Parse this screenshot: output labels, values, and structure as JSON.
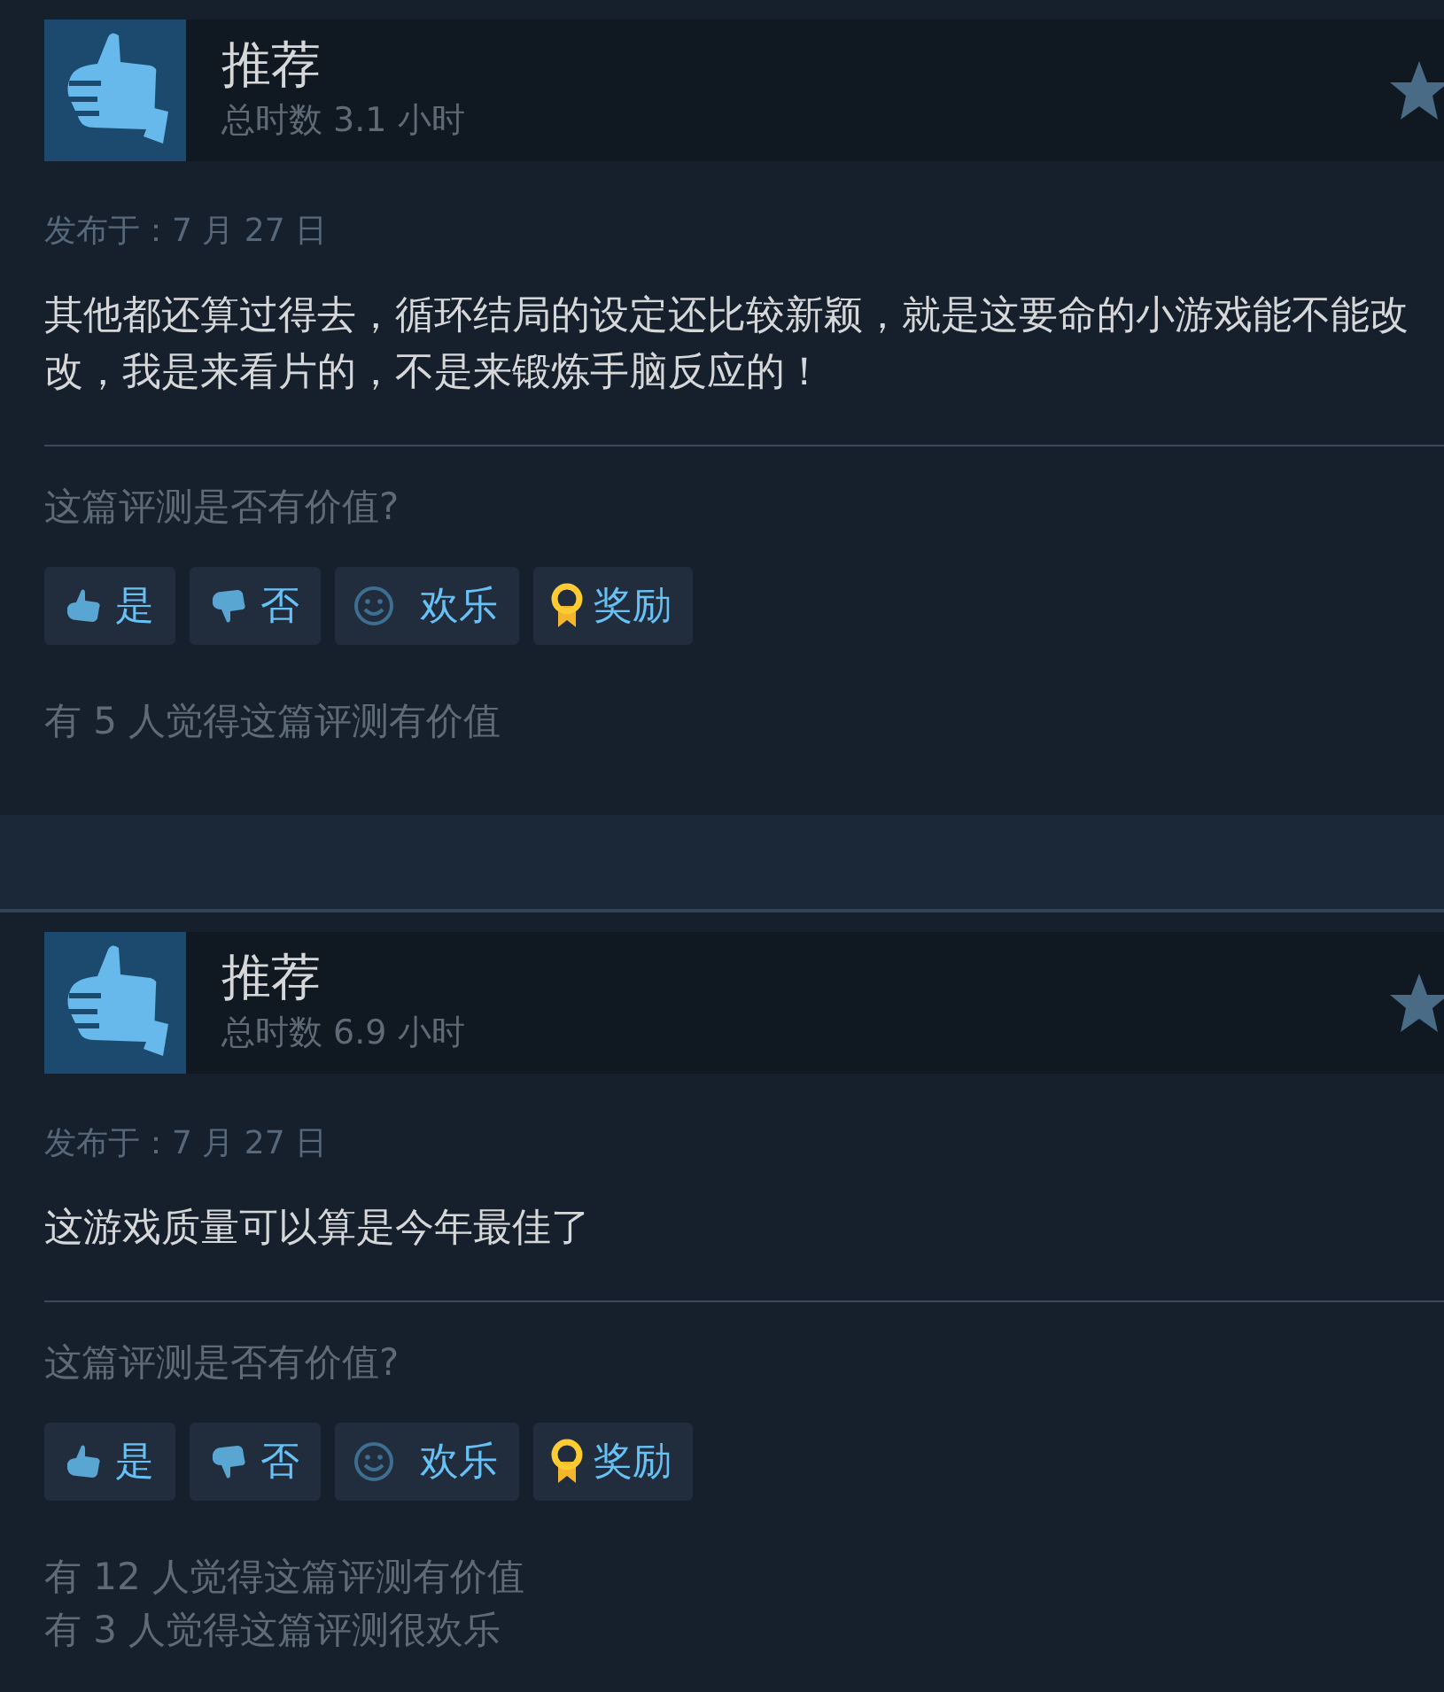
{
  "reviews": [
    {
      "verdict": "推荐",
      "hours": "总时数 3.1 小时",
      "posted": "发布于：7 月 27 日",
      "text": "其他都还算过得去，循环结局的设定还比较新颖，就是这要命的小游戏能不能改改，我是来看片的，不是来锻炼手脑反应的！",
      "question": "这篇评测是否有价值?",
      "buttons": [
        {
          "kind": "yes",
          "label": "是"
        },
        {
          "kind": "no",
          "label": "否"
        },
        {
          "kind": "funny",
          "label": "欢乐"
        },
        {
          "kind": "award",
          "label": "奖励"
        }
      ],
      "counts": [
        "有 5 人觉得这篇评测有价值"
      ]
    },
    {
      "verdict": "推荐",
      "hours": "总时数 6.9 小时",
      "posted": "发布于：7 月 27 日",
      "text": "这游戏质量可以算是今年最佳了",
      "question": "这篇评测是否有价值?",
      "buttons": [
        {
          "kind": "yes",
          "label": "是"
        },
        {
          "kind": "no",
          "label": "否"
        },
        {
          "kind": "funny",
          "label": "欢乐"
        },
        {
          "kind": "award",
          "label": "奖励"
        }
      ],
      "counts": [
        "有 12 人觉得这篇评测有价值",
        "有 3 人觉得这篇评测很欢乐"
      ]
    }
  ]
}
